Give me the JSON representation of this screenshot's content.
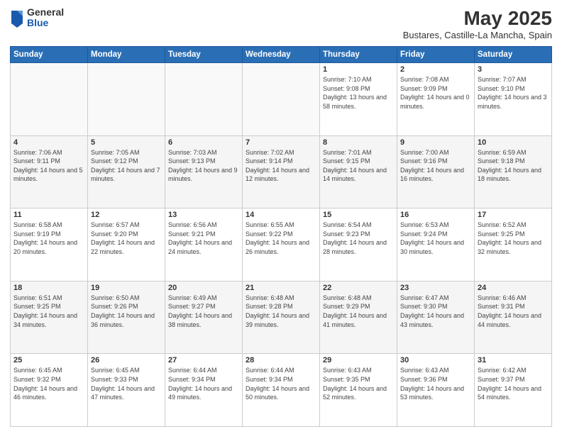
{
  "header": {
    "logo": {
      "general": "General",
      "blue": "Blue"
    },
    "title": "May 2025",
    "subtitle": "Bustares, Castille-La Mancha, Spain"
  },
  "weekdays": [
    "Sunday",
    "Monday",
    "Tuesday",
    "Wednesday",
    "Thursday",
    "Friday",
    "Saturday"
  ],
  "weeks": [
    [
      {
        "day": "",
        "sunrise": "",
        "sunset": "",
        "daylight": "",
        "empty": true
      },
      {
        "day": "",
        "sunrise": "",
        "sunset": "",
        "daylight": "",
        "empty": true
      },
      {
        "day": "",
        "sunrise": "",
        "sunset": "",
        "daylight": "",
        "empty": true
      },
      {
        "day": "",
        "sunrise": "",
        "sunset": "",
        "daylight": "",
        "empty": true
      },
      {
        "day": "1",
        "sunrise": "Sunrise: 7:10 AM",
        "sunset": "Sunset: 9:08 PM",
        "daylight": "Daylight: 13 hours and 58 minutes."
      },
      {
        "day": "2",
        "sunrise": "Sunrise: 7:08 AM",
        "sunset": "Sunset: 9:09 PM",
        "daylight": "Daylight: 14 hours and 0 minutes."
      },
      {
        "day": "3",
        "sunrise": "Sunrise: 7:07 AM",
        "sunset": "Sunset: 9:10 PM",
        "daylight": "Daylight: 14 hours and 3 minutes."
      }
    ],
    [
      {
        "day": "4",
        "sunrise": "Sunrise: 7:06 AM",
        "sunset": "Sunset: 9:11 PM",
        "daylight": "Daylight: 14 hours and 5 minutes."
      },
      {
        "day": "5",
        "sunrise": "Sunrise: 7:05 AM",
        "sunset": "Sunset: 9:12 PM",
        "daylight": "Daylight: 14 hours and 7 minutes."
      },
      {
        "day": "6",
        "sunrise": "Sunrise: 7:03 AM",
        "sunset": "Sunset: 9:13 PM",
        "daylight": "Daylight: 14 hours and 9 minutes."
      },
      {
        "day": "7",
        "sunrise": "Sunrise: 7:02 AM",
        "sunset": "Sunset: 9:14 PM",
        "daylight": "Daylight: 14 hours and 12 minutes."
      },
      {
        "day": "8",
        "sunrise": "Sunrise: 7:01 AM",
        "sunset": "Sunset: 9:15 PM",
        "daylight": "Daylight: 14 hours and 14 minutes."
      },
      {
        "day": "9",
        "sunrise": "Sunrise: 7:00 AM",
        "sunset": "Sunset: 9:16 PM",
        "daylight": "Daylight: 14 hours and 16 minutes."
      },
      {
        "day": "10",
        "sunrise": "Sunrise: 6:59 AM",
        "sunset": "Sunset: 9:18 PM",
        "daylight": "Daylight: 14 hours and 18 minutes."
      }
    ],
    [
      {
        "day": "11",
        "sunrise": "Sunrise: 6:58 AM",
        "sunset": "Sunset: 9:19 PM",
        "daylight": "Daylight: 14 hours and 20 minutes."
      },
      {
        "day": "12",
        "sunrise": "Sunrise: 6:57 AM",
        "sunset": "Sunset: 9:20 PM",
        "daylight": "Daylight: 14 hours and 22 minutes."
      },
      {
        "day": "13",
        "sunrise": "Sunrise: 6:56 AM",
        "sunset": "Sunset: 9:21 PM",
        "daylight": "Daylight: 14 hours and 24 minutes."
      },
      {
        "day": "14",
        "sunrise": "Sunrise: 6:55 AM",
        "sunset": "Sunset: 9:22 PM",
        "daylight": "Daylight: 14 hours and 26 minutes."
      },
      {
        "day": "15",
        "sunrise": "Sunrise: 6:54 AM",
        "sunset": "Sunset: 9:23 PM",
        "daylight": "Daylight: 14 hours and 28 minutes."
      },
      {
        "day": "16",
        "sunrise": "Sunrise: 6:53 AM",
        "sunset": "Sunset: 9:24 PM",
        "daylight": "Daylight: 14 hours and 30 minutes."
      },
      {
        "day": "17",
        "sunrise": "Sunrise: 6:52 AM",
        "sunset": "Sunset: 9:25 PM",
        "daylight": "Daylight: 14 hours and 32 minutes."
      }
    ],
    [
      {
        "day": "18",
        "sunrise": "Sunrise: 6:51 AM",
        "sunset": "Sunset: 9:25 PM",
        "daylight": "Daylight: 14 hours and 34 minutes."
      },
      {
        "day": "19",
        "sunrise": "Sunrise: 6:50 AM",
        "sunset": "Sunset: 9:26 PM",
        "daylight": "Daylight: 14 hours and 36 minutes."
      },
      {
        "day": "20",
        "sunrise": "Sunrise: 6:49 AM",
        "sunset": "Sunset: 9:27 PM",
        "daylight": "Daylight: 14 hours and 38 minutes."
      },
      {
        "day": "21",
        "sunrise": "Sunrise: 6:48 AM",
        "sunset": "Sunset: 9:28 PM",
        "daylight": "Daylight: 14 hours and 39 minutes."
      },
      {
        "day": "22",
        "sunrise": "Sunrise: 6:48 AM",
        "sunset": "Sunset: 9:29 PM",
        "daylight": "Daylight: 14 hours and 41 minutes."
      },
      {
        "day": "23",
        "sunrise": "Sunrise: 6:47 AM",
        "sunset": "Sunset: 9:30 PM",
        "daylight": "Daylight: 14 hours and 43 minutes."
      },
      {
        "day": "24",
        "sunrise": "Sunrise: 6:46 AM",
        "sunset": "Sunset: 9:31 PM",
        "daylight": "Daylight: 14 hours and 44 minutes."
      }
    ],
    [
      {
        "day": "25",
        "sunrise": "Sunrise: 6:45 AM",
        "sunset": "Sunset: 9:32 PM",
        "daylight": "Daylight: 14 hours and 46 minutes."
      },
      {
        "day": "26",
        "sunrise": "Sunrise: 6:45 AM",
        "sunset": "Sunset: 9:33 PM",
        "daylight": "Daylight: 14 hours and 47 minutes."
      },
      {
        "day": "27",
        "sunrise": "Sunrise: 6:44 AM",
        "sunset": "Sunset: 9:34 PM",
        "daylight": "Daylight: 14 hours and 49 minutes."
      },
      {
        "day": "28",
        "sunrise": "Sunrise: 6:44 AM",
        "sunset": "Sunset: 9:34 PM",
        "daylight": "Daylight: 14 hours and 50 minutes."
      },
      {
        "day": "29",
        "sunrise": "Sunrise: 6:43 AM",
        "sunset": "Sunset: 9:35 PM",
        "daylight": "Daylight: 14 hours and 52 minutes."
      },
      {
        "day": "30",
        "sunrise": "Sunrise: 6:43 AM",
        "sunset": "Sunset: 9:36 PM",
        "daylight": "Daylight: 14 hours and 53 minutes."
      },
      {
        "day": "31",
        "sunrise": "Sunrise: 6:42 AM",
        "sunset": "Sunset: 9:37 PM",
        "daylight": "Daylight: 14 hours and 54 minutes."
      }
    ]
  ]
}
